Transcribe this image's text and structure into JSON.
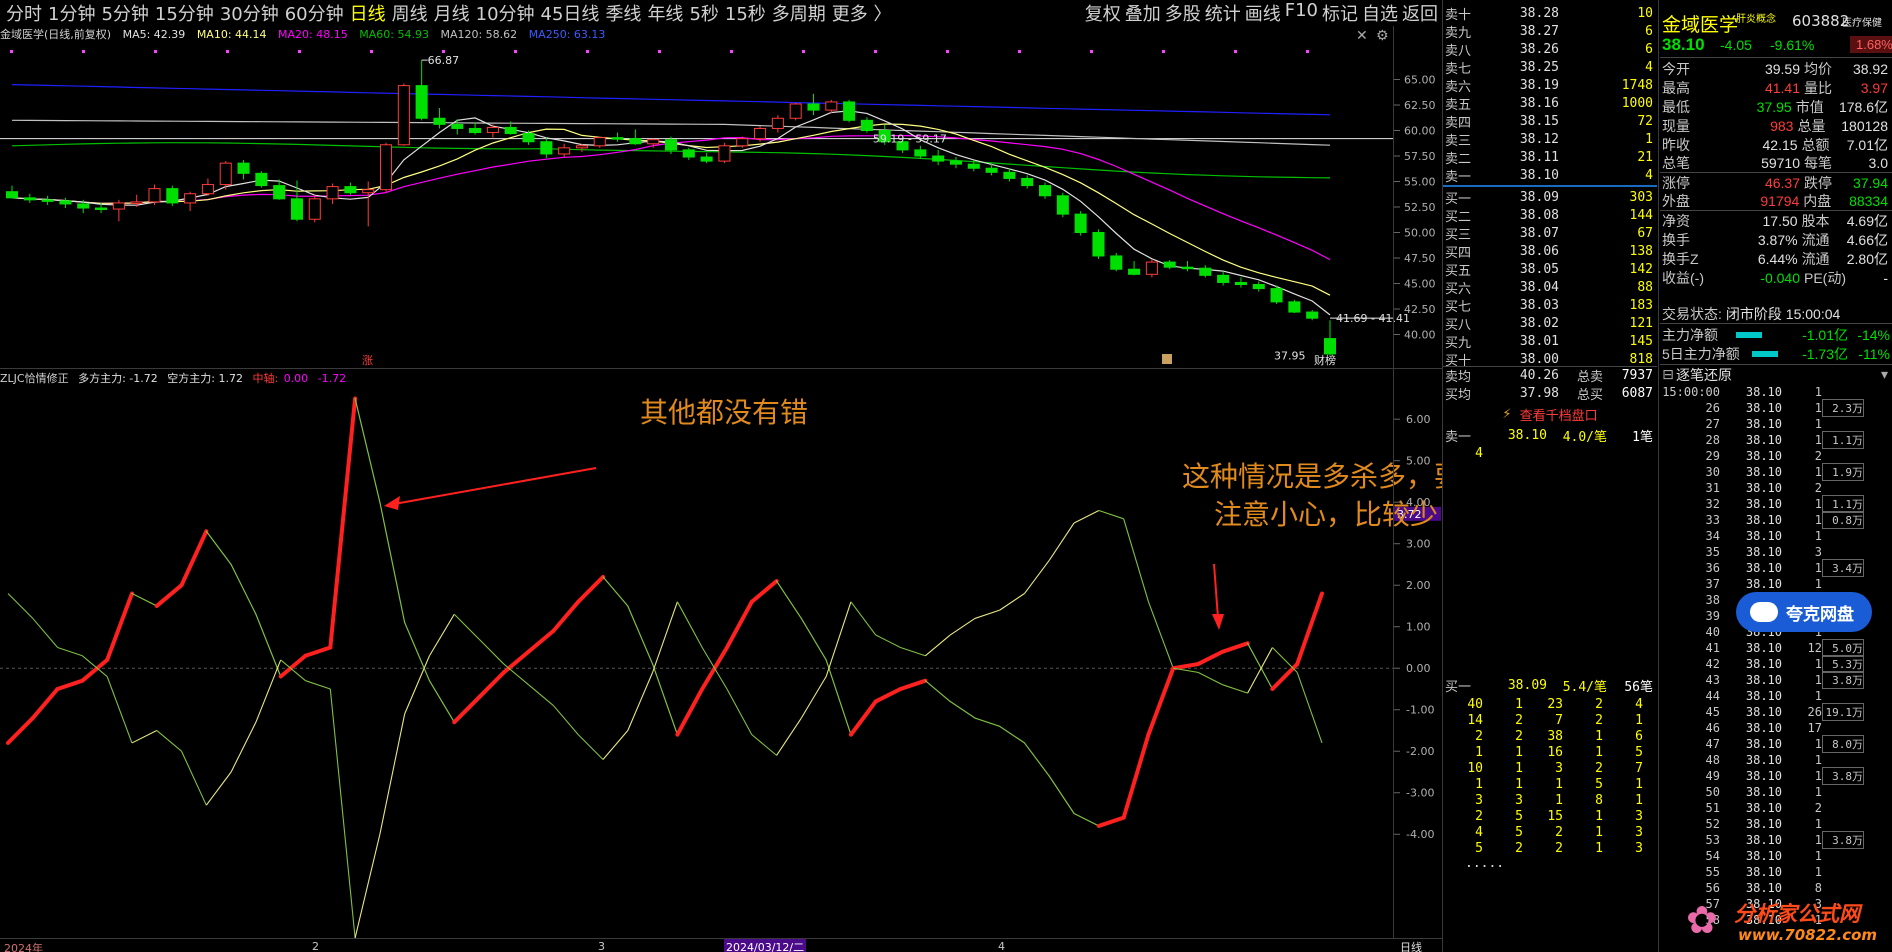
{
  "toolbar": {
    "periods": [
      "分时",
      "1分钟",
      "5分钟",
      "15分钟",
      "30分钟",
      "60分钟",
      "日线",
      "周线",
      "月线",
      "10分钟",
      "45日线",
      "季线",
      "年线",
      "5秒",
      "15秒",
      "多周期",
      "更多 〉"
    ],
    "active": "日线",
    "right": [
      "复权",
      "叠加",
      "多股",
      "统计",
      "画线",
      "F10",
      "标记",
      "自选",
      "返回"
    ]
  },
  "kline_info": {
    "name": "金域医学(日线,前复权)",
    "ma5": "MA5: 42.39",
    "ma10": "MA10: 44.14",
    "ma20": "MA20: 48.15",
    "ma60": "MA60: 54.93",
    "ma120": "MA120: 58.62",
    "ma250": "MA250: 63.13",
    "high_label": "66.87",
    "low_label": "37.95",
    "range_label1": "59.19 - 59.17",
    "range_label2": "41.69 - 41.41",
    "zhang_mark": "涨",
    "caibang_mark": "财榜"
  },
  "main_axis": [
    "65.00",
    "62.50",
    "60.00",
    "57.50",
    "55.00",
    "52.50",
    "50.00",
    "47.50",
    "45.00",
    "42.50",
    "40.00"
  ],
  "sub_info": {
    "name": "ZLJC恰情修正",
    "duo": "多方主力: -1.72",
    "kong": "空方主力: 1.72",
    "zhongzhou_label": "中轴:",
    "zhongzhou": "0.00",
    "extra": "-1.72",
    "marker": "3.72"
  },
  "sub_axis": [
    "6.00",
    "5.00",
    "4.00",
    "3.00",
    "2.00",
    "1.00",
    "0.00",
    "-1.00",
    "-2.00",
    "-3.00",
    "-4.00"
  ],
  "annotations": {
    "a1": "其他都没有错",
    "a2_line1": "这种情况是多杀多，要",
    "a2_line2": "注意小心，比较少"
  },
  "time_axis": [
    "2024年",
    "2",
    "3",
    "2024/03/12/二",
    "4"
  ],
  "period_label": "日线",
  "orderbook": {
    "sells": [
      {
        "label": "卖十",
        "price": "38.28",
        "vol": "10"
      },
      {
        "label": "卖九",
        "price": "38.27",
        "vol": "6"
      },
      {
        "label": "卖八",
        "price": "38.26",
        "vol": "6"
      },
      {
        "label": "卖七",
        "price": "38.25",
        "vol": "4"
      },
      {
        "label": "卖六",
        "price": "38.19",
        "vol": "1748"
      },
      {
        "label": "卖五",
        "price": "38.16",
        "vol": "1000"
      },
      {
        "label": "卖四",
        "price": "38.15",
        "vol": "72"
      },
      {
        "label": "卖三",
        "price": "38.12",
        "vol": "1"
      },
      {
        "label": "卖二",
        "price": "38.11",
        "vol": "21"
      },
      {
        "label": "卖一",
        "price": "38.10",
        "vol": "4"
      }
    ],
    "buys": [
      {
        "label": "买一",
        "price": "38.09",
        "vol": "303"
      },
      {
        "label": "买二",
        "price": "38.08",
        "vol": "144"
      },
      {
        "label": "买三",
        "price": "38.07",
        "vol": "67"
      },
      {
        "label": "买四",
        "price": "38.06",
        "vol": "138"
      },
      {
        "label": "买五",
        "price": "38.05",
        "vol": "142"
      },
      {
        "label": "买六",
        "price": "38.04",
        "vol": "88"
      },
      {
        "label": "买七",
        "price": "38.03",
        "vol": "183"
      },
      {
        "label": "买八",
        "price": "38.02",
        "vol": "121"
      },
      {
        "label": "买九",
        "price": "38.01",
        "vol": "145"
      },
      {
        "label": "买十",
        "price": "38.00",
        "vol": "818"
      }
    ],
    "avg_sell": {
      "label": "卖均",
      "price": "40.26",
      "k": "总卖",
      "v": "7937"
    },
    "avg_buy": {
      "label": "买均",
      "price": "37.98",
      "k": "总买",
      "v": "6087"
    },
    "view_button": "查看千档盘口",
    "sell1_detail": {
      "label": "卖一",
      "price": "38.10",
      "per": "4.0/笔",
      "count": "1笔",
      "q": "4"
    },
    "buy1_detail": {
      "label": "买一",
      "price": "38.09",
      "per": "5.4/笔",
      "count": "56笔"
    },
    "buy_queue": [
      [
        "40",
        "1",
        "23",
        "2",
        "4"
      ],
      [
        "14",
        "2",
        "7",
        "2",
        "1"
      ],
      [
        "2",
        "2",
        "38",
        "1",
        "6"
      ],
      [
        "1",
        "1",
        "16",
        "1",
        "5"
      ],
      [
        "10",
        "1",
        "3",
        "2",
        "7"
      ],
      [
        "1",
        "1",
        "1",
        "5",
        "1"
      ],
      [
        "3",
        "3",
        "1",
        "8",
        "1"
      ],
      [
        "2",
        "5",
        "15",
        "1",
        "3"
      ],
      [
        "4",
        "5",
        "2",
        "1",
        "3"
      ],
      [
        "5",
        "2",
        "2",
        "1",
        "3"
      ]
    ],
    "more": "....."
  },
  "quote": {
    "name": "金域医学",
    "concept": "肝炎概念",
    "code": "603882",
    "sector": "医疗保健",
    "price": "38.10",
    "change": "-4.05",
    "pct": "-9.61%",
    "sector_pct": "1.68%",
    "rows": [
      {
        "k": "今开",
        "v": "39.59",
        "k2": "均价",
        "v2": "38.92"
      },
      {
        "k": "最高",
        "v": "41.41",
        "k2": "量比",
        "v2": "3.97"
      },
      {
        "k": "最低",
        "v": "37.95",
        "k2": "市值",
        "v2": "178.6亿"
      },
      {
        "k": "现量",
        "v": "983",
        "k2": "总量",
        "v2": "180128"
      },
      {
        "k": "昨收",
        "v": "42.15",
        "k2": "总额",
        "v2": "7.01亿"
      },
      {
        "k": "总笔",
        "v": "59710",
        "k2": "每笔",
        "v2": "3.0"
      },
      {
        "k": "涨停",
        "v": "46.37",
        "k2": "跌停",
        "v2": "37.94"
      },
      {
        "k": "外盘",
        "v": "91794",
        "k2": "内盘",
        "v2": "88334"
      },
      {
        "k": "净资",
        "v": "17.50",
        "k2": "股本",
        "v2": "4.69亿"
      },
      {
        "k": "换手",
        "v": "3.87%",
        "k2": "流通",
        "v2": "4.66亿"
      },
      {
        "k": "换手Z",
        "v": "6.44%",
        "k2": "流通",
        "v2": "2.80亿"
      },
      {
        "k": "收益(-)",
        "v": "-0.040",
        "k2": "PE(动)",
        "v2": "-"
      }
    ],
    "trade_state_label": "交易状态:",
    "trade_state": "闭市阶段 15:00:04",
    "main_net_label": "主力净额",
    "main_net": "-1.01亿",
    "main_net_pct": "-14%",
    "main5_label": "5日主力净额",
    "main5": "-1.73亿",
    "main5_pct": "-11%"
  },
  "ticks": {
    "title": "逐笔还原",
    "rows": [
      {
        "t": "15:00:00",
        "p": "38.10",
        "v": "1",
        "b": ""
      },
      {
        "t": "26",
        "p": "38.10",
        "v": "1",
        "b": "2.3万"
      },
      {
        "t": "27",
        "p": "38.10",
        "v": "1",
        "b": ""
      },
      {
        "t": "28",
        "p": "38.10",
        "v": "1",
        "b": "1.1万"
      },
      {
        "t": "29",
        "p": "38.10",
        "v": "2",
        "b": ""
      },
      {
        "t": "30",
        "p": "38.10",
        "v": "1",
        "b": "1.9万"
      },
      {
        "t": "31",
        "p": "38.10",
        "v": "2",
        "b": ""
      },
      {
        "t": "32",
        "p": "38.10",
        "v": "1",
        "b": "1.1万"
      },
      {
        "t": "33",
        "p": "38.10",
        "v": "1",
        "b": "0.8万"
      },
      {
        "t": "34",
        "p": "38.10",
        "v": "1",
        "b": ""
      },
      {
        "t": "35",
        "p": "38.10",
        "v": "3",
        "b": ""
      },
      {
        "t": "36",
        "p": "38.10",
        "v": "1",
        "b": "3.4万"
      },
      {
        "t": "37",
        "p": "38.10",
        "v": "1",
        "b": ""
      },
      {
        "t": "38",
        "p": "38.10",
        "v": "1",
        "b": ""
      },
      {
        "t": "39",
        "p": "38.10",
        "v": "1",
        "b": ""
      },
      {
        "t": "40",
        "p": "38.10",
        "v": "1",
        "b": ""
      },
      {
        "t": "41",
        "p": "38.10",
        "v": "12",
        "b": "5.0万"
      },
      {
        "t": "42",
        "p": "38.10",
        "v": "1",
        "b": "5.3万"
      },
      {
        "t": "43",
        "p": "38.10",
        "v": "1",
        "b": "3.8万"
      },
      {
        "t": "44",
        "p": "38.10",
        "v": "1",
        "b": ""
      },
      {
        "t": "45",
        "p": "38.10",
        "v": "26",
        "b": "19.1万"
      },
      {
        "t": "46",
        "p": "38.10",
        "v": "17",
        "b": ""
      },
      {
        "t": "47",
        "p": "38.10",
        "v": "1",
        "b": "8.0万"
      },
      {
        "t": "48",
        "p": "38.10",
        "v": "1",
        "b": ""
      },
      {
        "t": "49",
        "p": "38.10",
        "v": "1",
        "b": "3.8万"
      },
      {
        "t": "50",
        "p": "38.10",
        "v": "1",
        "b": ""
      },
      {
        "t": "51",
        "p": "38.10",
        "v": "2",
        "b": ""
      },
      {
        "t": "52",
        "p": "38.10",
        "v": "1",
        "b": ""
      },
      {
        "t": "53",
        "p": "38.10",
        "v": "1",
        "b": "3.8万"
      },
      {
        "t": "54",
        "p": "38.10",
        "v": "1",
        "b": ""
      },
      {
        "t": "55",
        "p": "38.10",
        "v": "1",
        "b": ""
      },
      {
        "t": "56",
        "p": "38.10",
        "v": "8",
        "b": ""
      },
      {
        "t": "57",
        "p": "38.10",
        "v": "3",
        "b": ""
      },
      {
        "t": "58",
        "p": "38.10",
        "v": "1",
        "b": ""
      }
    ]
  },
  "watermark": {
    "pan": "夸克网盘",
    "site": "分析家公式网",
    "url": "www.70822.com"
  },
  "colors": {
    "up": "#ff3b3b",
    "down": "#00e000",
    "ma5": "#e0e0e0",
    "ma10": "#ffff80",
    "ma20": "#ff00ff",
    "ma60": "#00c000",
    "ma120": "#c0c0c0",
    "ma250": "#2020ff",
    "annot": "#e08a1e",
    "accent": "#ffff00"
  },
  "chart_data": {
    "main": {
      "type": "candlestick",
      "ylim": [
        37.5,
        67.5
      ],
      "candles": [
        [
          54.0,
          54.6,
          53.5,
          53.4
        ],
        [
          53.4,
          53.8,
          52.9,
          53.2
        ],
        [
          53.2,
          53.6,
          52.7,
          53.1
        ],
        [
          53.1,
          53.4,
          52.4,
          52.8
        ],
        [
          52.8,
          53.2,
          51.9,
          52.4
        ],
        [
          52.4,
          52.9,
          51.9,
          52.3
        ],
        [
          52.3,
          53.2,
          51.1,
          52.9
        ],
        [
          52.9,
          53.7,
          52.5,
          53.0
        ],
        [
          53.0,
          54.7,
          52.7,
          54.3
        ],
        [
          54.3,
          54.6,
          52.6,
          52.9
        ],
        [
          52.9,
          54.0,
          52.1,
          53.8
        ],
        [
          53.8,
          55.3,
          53.6,
          54.7
        ],
        [
          54.7,
          57.0,
          54.2,
          56.8
        ],
        [
          56.8,
          57.1,
          55.2,
          55.8
        ],
        [
          55.8,
          56.0,
          54.4,
          54.6
        ],
        [
          54.6,
          55.2,
          53.2,
          53.3
        ],
        [
          53.3,
          55.1,
          51.1,
          51.3
        ],
        [
          51.3,
          53.7,
          51.0,
          53.3
        ],
        [
          53.3,
          54.8,
          52.8,
          54.5
        ],
        [
          54.5,
          54.9,
          53.7,
          53.9
        ],
        [
          53.9,
          55.0,
          50.6,
          54.2
        ],
        [
          54.2,
          58.8,
          54.0,
          58.6
        ],
        [
          58.6,
          64.6,
          58.5,
          64.4
        ],
        [
          64.4,
          66.9,
          61.0,
          61.2
        ],
        [
          61.2,
          62.2,
          60.2,
          60.6
        ],
        [
          60.6,
          61.1,
          59.6,
          60.2
        ],
        [
          60.2,
          60.8,
          59.6,
          59.8
        ],
        [
          59.8,
          60.6,
          59.3,
          60.3
        ],
        [
          60.3,
          60.9,
          59.6,
          59.7
        ],
        [
          59.7,
          60.0,
          58.6,
          58.9
        ],
        [
          58.9,
          59.3,
          57.3,
          57.7
        ],
        [
          57.7,
          58.7,
          57.4,
          58.3
        ],
        [
          58.3,
          58.7,
          57.9,
          58.5
        ],
        [
          58.5,
          59.4,
          58.3,
          59.3
        ],
        [
          59.3,
          59.8,
          58.9,
          59.2
        ],
        [
          59.2,
          60.1,
          58.6,
          58.7
        ],
        [
          58.7,
          59.2,
          58.3,
          59.1
        ],
        [
          59.1,
          59.4,
          57.7,
          58.1
        ],
        [
          58.1,
          58.3,
          57.1,
          57.4
        ],
        [
          57.4,
          57.8,
          56.8,
          57.0
        ],
        [
          57.0,
          58.8,
          56.8,
          58.5
        ],
        [
          58.5,
          59.4,
          58.3,
          59.2
        ],
        [
          59.2,
          60.4,
          58.9,
          60.2
        ],
        [
          60.2,
          61.5,
          59.8,
          61.2
        ],
        [
          61.2,
          62.7,
          61.0,
          62.6
        ],
        [
          62.6,
          63.6,
          61.5,
          62.0
        ],
        [
          62.0,
          63.0,
          61.7,
          62.8
        ],
        [
          62.8,
          63.0,
          60.8,
          61.0
        ],
        [
          61.0,
          61.3,
          59.8,
          60.0
        ],
        [
          60.0,
          60.6,
          58.6,
          58.9
        ],
        [
          58.9,
          59.2,
          57.8,
          58.1
        ],
        [
          58.1,
          58.5,
          57.2,
          57.5
        ],
        [
          57.5,
          58.1,
          56.6,
          57.0
        ],
        [
          57.0,
          57.4,
          56.3,
          56.7
        ],
        [
          56.7,
          57.1,
          56.0,
          56.3
        ],
        [
          56.3,
          56.8,
          55.6,
          55.9
        ],
        [
          55.9,
          56.3,
          55.0,
          55.3
        ],
        [
          55.3,
          55.6,
          54.3,
          54.6
        ],
        [
          54.6,
          54.9,
          53.3,
          53.6
        ],
        [
          53.6,
          53.9,
          51.5,
          51.8
        ],
        [
          51.8,
          52.1,
          49.7,
          50.0
        ],
        [
          50.0,
          50.3,
          47.4,
          47.7
        ],
        [
          47.7,
          48.0,
          46.2,
          46.4
        ],
        [
          46.4,
          47.2,
          45.8,
          45.9
        ],
        [
          45.9,
          47.4,
          45.6,
          47.1
        ],
        [
          47.1,
          47.3,
          46.4,
          46.6
        ],
        [
          46.6,
          47.2,
          46.2,
          46.5
        ],
        [
          46.5,
          46.8,
          45.6,
          45.8
        ],
        [
          45.8,
          46.2,
          44.8,
          45.1
        ],
        [
          45.1,
          45.6,
          44.6,
          44.9
        ],
        [
          44.9,
          45.2,
          44.2,
          44.5
        ],
        [
          44.5,
          44.8,
          43.0,
          43.2
        ],
        [
          43.2,
          43.4,
          42.1,
          42.2
        ],
        [
          42.2,
          42.4,
          41.4,
          41.6
        ],
        [
          39.6,
          41.4,
          37.95,
          38.1
        ]
      ]
    },
    "sub": {
      "type": "line",
      "ylim": [
        -6.5,
        6.8
      ],
      "series": [
        {
          "name": "多方主力",
          "values": [
            -1.8,
            -1.2,
            -0.5,
            -0.3,
            0.2,
            1.8,
            1.5,
            2.0,
            3.3,
            2.5,
            1.3,
            -0.2,
            0.3,
            0.5,
            6.5,
            4.0,
            1.1,
            -0.3,
            -1.3,
            -0.7,
            -0.1,
            0.4,
            0.9,
            1.6,
            2.2,
            1.5,
            0.1,
            -1.6,
            -0.5,
            0.5,
            1.6,
            2.1,
            1.2,
            0.2,
            -1.6,
            -0.8,
            -0.5,
            -0.3,
            -0.8,
            -1.2,
            -1.4,
            -1.8,
            -2.6,
            -3.5,
            -3.8,
            -3.6,
            -1.6,
            0.0,
            0.1,
            0.4,
            0.6,
            -0.5,
            0.1,
            1.8
          ]
        }
      ]
    }
  }
}
